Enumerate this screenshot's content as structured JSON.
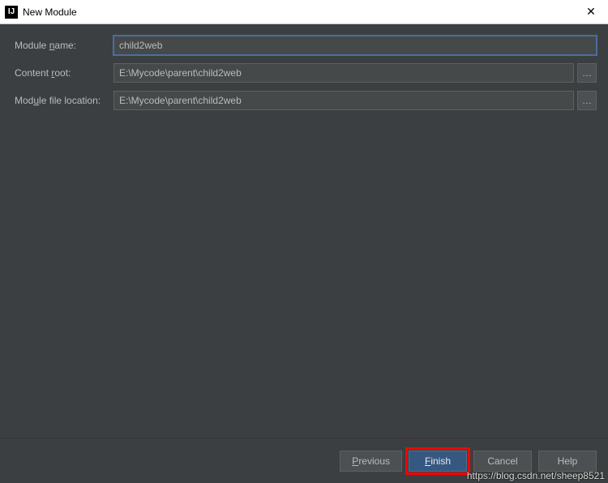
{
  "titlebar": {
    "title": "New Module",
    "close": "✕"
  },
  "form": {
    "module_name_label": "Module name:",
    "module_name_value": "child2web",
    "content_root_label": "Content root:",
    "content_root_value": "E:\\Mycode\\parent\\child2web",
    "module_file_label": "Module file location:",
    "module_file_value": "E:\\Mycode\\parent\\child2web",
    "browse": "…"
  },
  "footer": {
    "previous": "Previous",
    "finish": "Finish",
    "cancel": "Cancel",
    "help": "Help"
  },
  "watermark": "https://blog.csdn.net/sheep8521"
}
